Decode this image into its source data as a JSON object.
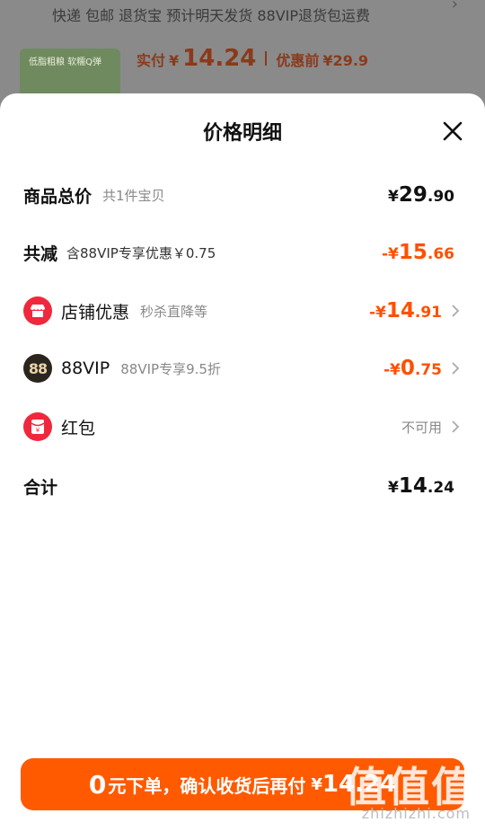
{
  "background": {
    "shipping_line": "快递 包邮 退货宝 预计明天发货 88VIP退货包运费",
    "thumb_text": "低脂粗粮 软糯Q弹",
    "actual_label": "实付",
    "actual_currency": "¥",
    "actual_amount": "14.24",
    "before_label": "优惠前",
    "before_amount": "¥29.9"
  },
  "sheet": {
    "title": "价格明细",
    "rows": {
      "total": {
        "label": "商品总价",
        "sub": "共1件宝贝",
        "currency": "¥",
        "int": "29",
        "dec": ".90"
      },
      "reduce": {
        "label": "共减",
        "sub": "含88VIP专享优惠￥0.75",
        "currency": "-¥",
        "int": "15",
        "dec": ".66"
      },
      "shop": {
        "label": "店铺优惠",
        "sub": "秒杀直降等",
        "currency": "-¥",
        "int": "14",
        "dec": ".91",
        "icon": "shop-icon"
      },
      "vip": {
        "label": "88VIP",
        "sub": "88VIP专享9.5折",
        "currency": "-¥",
        "int": "0",
        "dec": ".75",
        "icon_text": "88"
      },
      "redpacket": {
        "label": "红包",
        "status": "不可用",
        "icon": "red-packet-icon"
      },
      "sum": {
        "label": "合计",
        "currency": "¥",
        "int": "14",
        "dec": ".24"
      }
    }
  },
  "pay_button": {
    "zero": "0",
    "text": "元下单，确认收货后再付",
    "currency": "¥",
    "amount": "14.24"
  },
  "watermark": {
    "logo": "值值值",
    "url": "zhizhizhi.com"
  },
  "colors": {
    "accent": "#ff5000",
    "button": "#ff5a00",
    "shop_icon": "#f0283c"
  }
}
